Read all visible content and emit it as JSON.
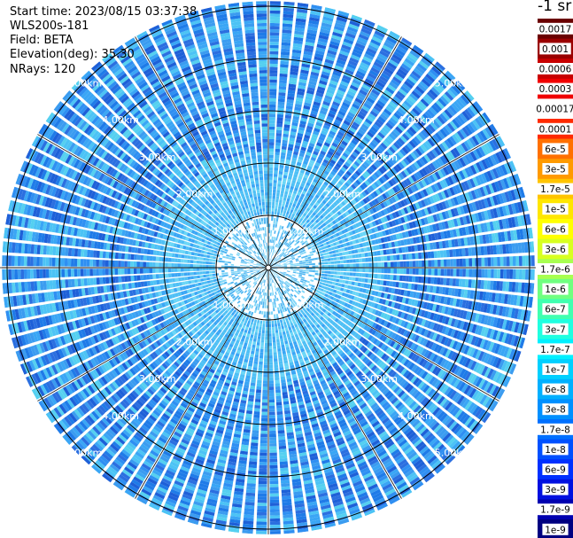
{
  "header": {
    "start_time": "Start time: 2023/08/15 03:37:38",
    "instrument": "WLS200s-181",
    "field": "Field: BETA",
    "elevation": "Elevation(deg): 35.30",
    "nrays": "NRays: 120"
  },
  "colorbar": {
    "units": "-1 sr",
    "labels": [
      "0.0017",
      "0.001",
      "0.0006",
      "0.0003",
      "0.00017",
      "0.0001",
      "6e-5",
      "3e-5",
      "1.7e-5",
      "1e-5",
      "6e-6",
      "3e-6",
      "1.7e-6",
      "1e-6",
      "6e-7",
      "3e-7",
      "1.7e-7",
      "1e-7",
      "6e-8",
      "3e-8",
      "1.7e-8",
      "1e-8",
      "6e-9",
      "3e-9",
      "1.7e-9",
      "1e-9"
    ],
    "colors": [
      "#6a0000",
      "#9a0000",
      "#c80000",
      "#f00000",
      "#ffffff",
      "#ff2a00",
      "#ff7000",
      "#ff9a00",
      "#ffc400",
      "#ffe600",
      "#ffff00",
      "#d8ff20",
      "#a8ff50",
      "#70ff80",
      "#40ffb0",
      "#20ffe0",
      "#00f0ff",
      "#00d0ff",
      "#00b0ff",
      "#0090ff",
      "#0070ff",
      "#0050ff",
      "#0030ff",
      "#0010e0",
      "#0000b0",
      "#000080"
    ]
  },
  "chart_data": {
    "type": "ppi",
    "field": "BETA",
    "nrays": 120,
    "range_rings_km": [
      1,
      2,
      3,
      4,
      5
    ],
    "ring_labels": [
      "1.00km",
      "2.00km",
      "3.00km",
      "4.00km",
      "5.00km"
    ],
    "max_range_km": 5.1,
    "spoke_spacing_deg": 30
  }
}
